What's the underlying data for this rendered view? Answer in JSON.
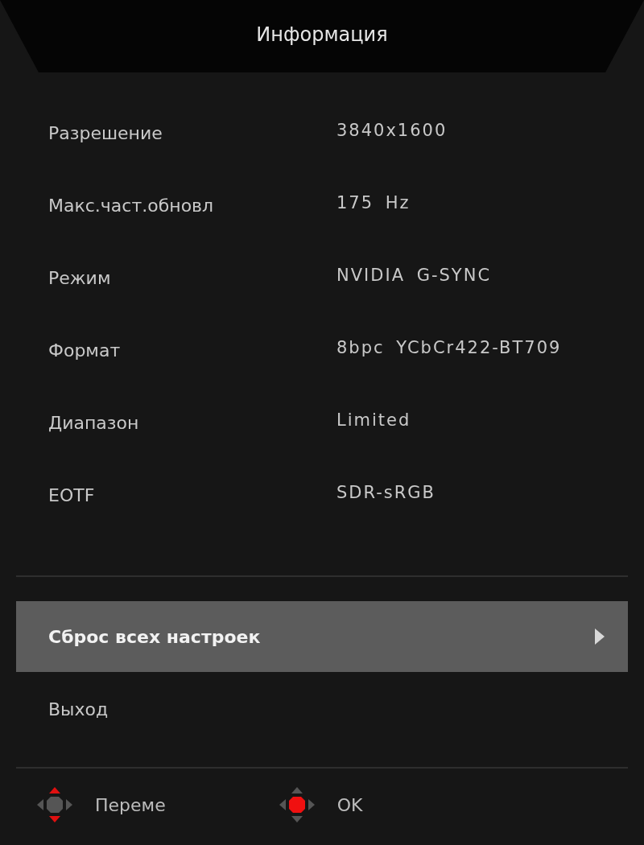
{
  "title": "Информация",
  "info_rows": [
    {
      "label": "Разрешение",
      "value": "3840x1600"
    },
    {
      "label": "Макс.част.обновл",
      "value": "175 Hz"
    },
    {
      "label": "Режим",
      "value": "NVIDIA G-SYNC"
    },
    {
      "label": "Формат",
      "value": "8bpc YCbCr422-BT709"
    },
    {
      "label": "Диапазон",
      "value": "Limited"
    },
    {
      "label": "EOTF",
      "value": "SDR-sRGB"
    }
  ],
  "menu_items": [
    {
      "label": "Сброс всех настроек",
      "selected": true,
      "kind": "submenu"
    },
    {
      "label": "Выход",
      "selected": false,
      "kind": "action"
    }
  ],
  "hints": [
    {
      "kind": "navigate",
      "label": "Переме"
    },
    {
      "kind": "ok",
      "label": "OK"
    }
  ]
}
